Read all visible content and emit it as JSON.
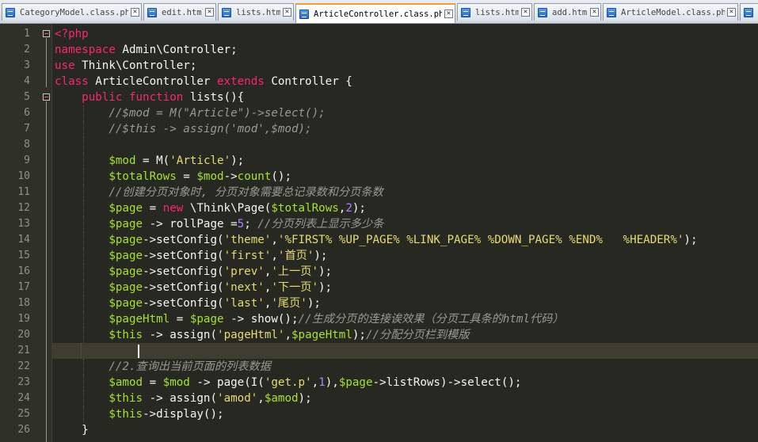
{
  "tabs": [
    {
      "label": "CategoryModel.class.php",
      "active": false
    },
    {
      "label": "edit.html",
      "active": false
    },
    {
      "label": "lists.html",
      "active": false
    },
    {
      "label": "ArticleController.class.php",
      "active": true
    },
    {
      "label": "lists.html",
      "active": false
    },
    {
      "label": "add.html",
      "active": false
    },
    {
      "label": "ArticleModel.class.php",
      "active": false
    }
  ],
  "editor": {
    "current_line": 21,
    "line_numbers": [
      "1",
      "2",
      "3",
      "4",
      "5",
      "6",
      "7",
      "8",
      "9",
      "10",
      "11",
      "12",
      "13",
      "14",
      "15",
      "16",
      "17",
      "18",
      "19",
      "20",
      "21",
      "22",
      "23",
      "24",
      "25",
      "26"
    ],
    "lines": [
      [
        [
          "ph",
          "<?php"
        ]
      ],
      [
        [
          "kw",
          "namespace"
        ],
        [
          "op",
          " Admin\\Controller;"
        ]
      ],
      [
        [
          "kw",
          "use"
        ],
        [
          "op",
          " Think\\Controller;"
        ]
      ],
      [
        [
          "kw",
          "class"
        ],
        [
          "op",
          " ArticleController "
        ],
        [
          "kw",
          "extends"
        ],
        [
          "op",
          " Controller {"
        ]
      ],
      [
        [
          "op",
          "    "
        ],
        [
          "kw",
          "public"
        ],
        [
          "op",
          " "
        ],
        [
          "kw",
          "function"
        ],
        [
          "op",
          " lists(){"
        ]
      ],
      [
        [
          "op",
          "        "
        ],
        [
          "cm",
          "//$mod = M(\"Article\")->select();"
        ]
      ],
      [
        [
          "op",
          "        "
        ],
        [
          "cm",
          "//$this -> assign('mod',$mod);"
        ]
      ],
      [
        [
          "op",
          ""
        ]
      ],
      [
        [
          "op",
          "        "
        ],
        [
          "var",
          "$mod"
        ],
        [
          "op",
          " = M("
        ],
        [
          "str",
          "'Article'"
        ],
        [
          "op",
          ");"
        ]
      ],
      [
        [
          "op",
          "        "
        ],
        [
          "var",
          "$totalRows"
        ],
        [
          "op",
          " = "
        ],
        [
          "var",
          "$mod"
        ],
        [
          "op",
          "->"
        ],
        [
          "var",
          "count"
        ],
        [
          "op",
          "();"
        ]
      ],
      [
        [
          "op",
          "        "
        ],
        [
          "cm",
          "//创建分页对象时, 分页对象需要总记录数和分页条数"
        ]
      ],
      [
        [
          "op",
          "        "
        ],
        [
          "var",
          "$page"
        ],
        [
          "op",
          " = "
        ],
        [
          "kw",
          "new"
        ],
        [
          "op",
          " \\Think\\Page("
        ],
        [
          "var",
          "$totalRows"
        ],
        [
          "op",
          ","
        ],
        [
          "num",
          "2"
        ],
        [
          "op",
          ");"
        ]
      ],
      [
        [
          "op",
          "        "
        ],
        [
          "var",
          "$page"
        ],
        [
          "op",
          " -> rollPage ="
        ],
        [
          "num",
          "5"
        ],
        [
          "op",
          "; "
        ],
        [
          "cm",
          "//分页列表上显示多少条"
        ]
      ],
      [
        [
          "op",
          "        "
        ],
        [
          "var",
          "$page"
        ],
        [
          "op",
          "->setConfig("
        ],
        [
          "str",
          "'theme'"
        ],
        [
          "op",
          ","
        ],
        [
          "str",
          "'%FIRST% %UP_PAGE% %LINK_PAGE% %DOWN_PAGE% %END%   %HEADER%'"
        ],
        [
          "op",
          ");"
        ]
      ],
      [
        [
          "op",
          "        "
        ],
        [
          "var",
          "$page"
        ],
        [
          "op",
          "->setConfig("
        ],
        [
          "str",
          "'first'"
        ],
        [
          "op",
          ","
        ],
        [
          "str",
          "'首页'"
        ],
        [
          "op",
          ");"
        ]
      ],
      [
        [
          "op",
          "        "
        ],
        [
          "var",
          "$page"
        ],
        [
          "op",
          "->setConfig("
        ],
        [
          "str",
          "'prev'"
        ],
        [
          "op",
          ","
        ],
        [
          "str",
          "'上一页'"
        ],
        [
          "op",
          ");"
        ]
      ],
      [
        [
          "op",
          "        "
        ],
        [
          "var",
          "$page"
        ],
        [
          "op",
          "->setConfig("
        ],
        [
          "str",
          "'next'"
        ],
        [
          "op",
          ","
        ],
        [
          "str",
          "'下一页'"
        ],
        [
          "op",
          ");"
        ]
      ],
      [
        [
          "op",
          "        "
        ],
        [
          "var",
          "$page"
        ],
        [
          "op",
          "->setConfig("
        ],
        [
          "str",
          "'last'"
        ],
        [
          "op",
          ","
        ],
        [
          "str",
          "'尾页'"
        ],
        [
          "op",
          ");"
        ]
      ],
      [
        [
          "op",
          "        "
        ],
        [
          "var",
          "$pageHtml"
        ],
        [
          "op",
          " = "
        ],
        [
          "var",
          "$page"
        ],
        [
          "op",
          " -> show();"
        ],
        [
          "cm",
          "//生成分页的连接诶效果（分页工具条的html代码）"
        ]
      ],
      [
        [
          "op",
          "        "
        ],
        [
          "var",
          "$this"
        ],
        [
          "op",
          " -> assign("
        ],
        [
          "str",
          "'pageHtml'"
        ],
        [
          "op",
          ","
        ],
        [
          "var",
          "$pageHtml"
        ],
        [
          "op",
          ");"
        ],
        [
          "cm",
          "//分配分页栏到模版"
        ]
      ],
      [
        [
          "op",
          ""
        ]
      ],
      [
        [
          "op",
          "        "
        ],
        [
          "cm",
          "//2.查询出当前页面的列表数据"
        ]
      ],
      [
        [
          "op",
          "        "
        ],
        [
          "var",
          "$amod"
        ],
        [
          "op",
          " = "
        ],
        [
          "var",
          "$mod"
        ],
        [
          "op",
          " -> page(I("
        ],
        [
          "str",
          "'get.p'"
        ],
        [
          "op",
          ","
        ],
        [
          "num",
          "1"
        ],
        [
          "op",
          "),"
        ],
        [
          "var",
          "$page"
        ],
        [
          "op",
          "->listRows)->select();"
        ]
      ],
      [
        [
          "op",
          "        "
        ],
        [
          "var",
          "$this"
        ],
        [
          "op",
          " -> assign("
        ],
        [
          "str",
          "'amod'"
        ],
        [
          "op",
          ","
        ],
        [
          "var",
          "$amod"
        ],
        [
          "op",
          ");"
        ]
      ],
      [
        [
          "op",
          "        "
        ],
        [
          "var",
          "$this"
        ],
        [
          "op",
          "->display();"
        ]
      ],
      [
        [
          "op",
          "    }"
        ]
      ]
    ]
  },
  "colors": {
    "background": "#272822",
    "keyword": "#f92672",
    "variable": "#a6e22e",
    "string": "#e6db74",
    "number": "#ae81ff",
    "comment": "#9a9a90",
    "active_tab_accent": "#f0a030"
  }
}
